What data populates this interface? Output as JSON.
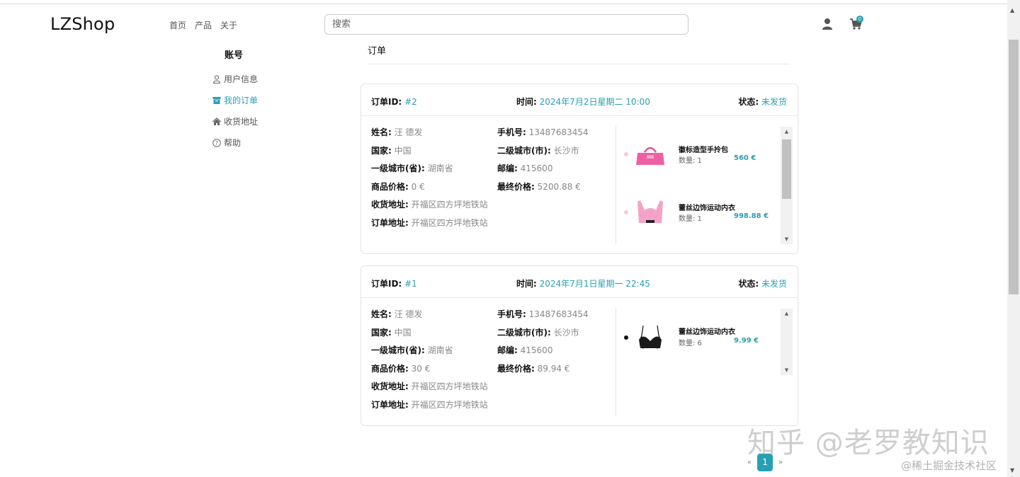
{
  "header": {
    "logo": "LZShop",
    "nav": [
      "首页",
      "产品",
      "关于"
    ],
    "search_placeholder": "搜索",
    "cart_count": "0"
  },
  "sidebar": {
    "title": "账号",
    "items": [
      {
        "label": "用户信息",
        "icon": "user-outline-icon",
        "active": false
      },
      {
        "label": "我的订单",
        "icon": "archive-box-icon",
        "active": true
      },
      {
        "label": "收货地址",
        "icon": "home-icon",
        "active": false
      },
      {
        "label": "帮助",
        "icon": "question-circle-icon",
        "active": false
      }
    ]
  },
  "main": {
    "title": "订单",
    "orders": [
      {
        "id_label": "订单ID:",
        "id": "#2",
        "time_label": "时间:",
        "time": "2024年7月2日星期二 10:00",
        "status_label": "状态:",
        "status": "未发货",
        "name_label": "姓名:",
        "name": "汪 德发",
        "phone_label": "手机号:",
        "phone": "13487683454",
        "country_label": "国家:",
        "country": "中国",
        "city2_label": "二级城市(市):",
        "city2": "长沙市",
        "city1_label": "一级城市(省):",
        "city1": "湖南省",
        "zip_label": "邮编:",
        "zip": "415600",
        "goods_price_label": "商品价格:",
        "goods_price": "0 €",
        "final_price_label": "最终价格:",
        "final_price": "5200.88 €",
        "ship_addr_label": "收货地址:",
        "ship_addr": "开福区四方坪地铁站",
        "order_addr_label": "订单地址:",
        "order_addr": "开福区四方坪地铁站",
        "items": [
          {
            "name": "徽标造型手拎包",
            "qty_label": "数量: 1",
            "price": "560 €",
            "bullet_color": "#f8c9d6"
          },
          {
            "name": "蕾丝边饰运动内衣",
            "qty_label": "数量: 1",
            "price": "998.88 €",
            "bullet_color": "#f8c9d6"
          }
        ]
      },
      {
        "id_label": "订单ID:",
        "id": "#1",
        "time_label": "时间:",
        "time": "2024年7月1日星期一 22:45",
        "status_label": "状态:",
        "status": "未发货",
        "name_label": "姓名:",
        "name": "汪 德发",
        "phone_label": "手机号:",
        "phone": "13487683454",
        "country_label": "国家:",
        "country": "中国",
        "city2_label": "二级城市(市):",
        "city2": "长沙市",
        "city1_label": "一级城市(省):",
        "city1": "湖南省",
        "zip_label": "邮编:",
        "zip": "415600",
        "goods_price_label": "商品价格:",
        "goods_price": "30 €",
        "final_price_label": "最终价格:",
        "final_price": "89.94 €",
        "ship_addr_label": "收货地址:",
        "ship_addr": "开福区四方坪地铁站",
        "order_addr_label": "订单地址:",
        "order_addr": "开福区四方坪地铁站",
        "items": [
          {
            "name": "蕾丝边饰运动内衣",
            "qty_label": "数量: 6",
            "price": "9.99 €",
            "bullet_color": "#111111"
          }
        ]
      }
    ]
  },
  "pagination": {
    "prev": "«",
    "current": "1",
    "next": "»"
  },
  "watermark": {
    "main": "知乎 @老罗教知识",
    "sub": "@稀土掘金技术社区"
  },
  "colors": {
    "accent": "#2a9eb2",
    "badge": "#28a0b4"
  }
}
